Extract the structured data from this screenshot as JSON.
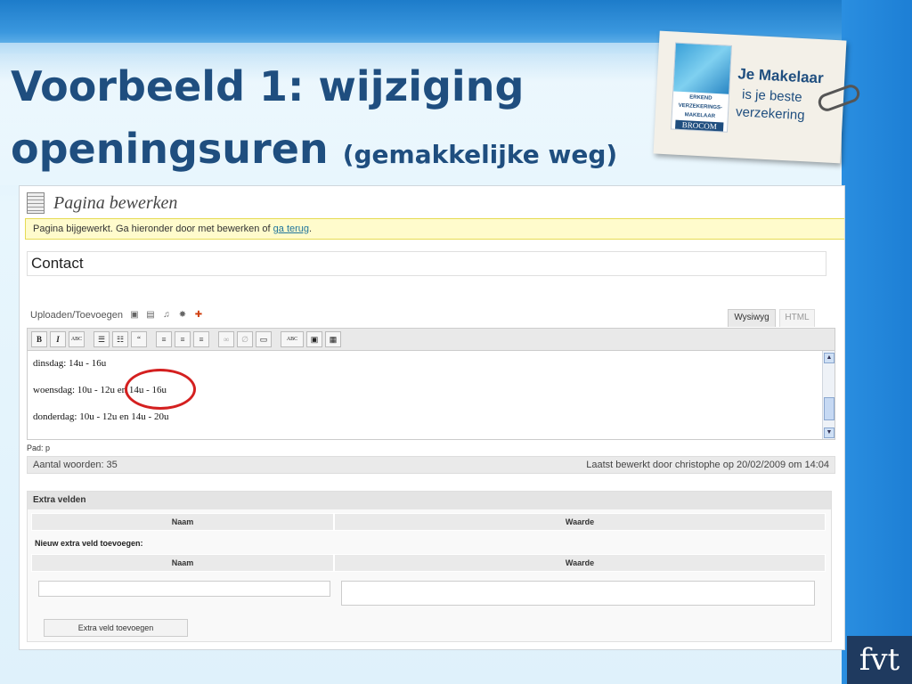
{
  "slide": {
    "title_line1": "Voorbeeld 1: wijziging",
    "title_line2": "openingsuren",
    "title_sub": "(gemakkelijke weg)"
  },
  "logo": {
    "badge_line1": "ERKEND",
    "badge_line2": "VERZEKERINGS-",
    "badge_line3": "MAKELAAR",
    "badge_brand": "BROCOM",
    "tag_line1": "Je Makelaar",
    "tag_line2": "is je beste",
    "tag_line3": "verzekering"
  },
  "editor_page": {
    "heading": "Pagina bewerken",
    "notice_text": "Pagina bijgewerkt. Ga hieronder door met bewerken of ",
    "notice_link": "ga terug",
    "notice_end": ".",
    "title_value": "Contact",
    "upload_label": "Uploaden/Toevoegen",
    "tab_wysiwyg": "Wysiwyg",
    "tab_html": "HTML",
    "toolbar": {
      "bold": "B",
      "italic": "I",
      "strike": "ABC",
      "bullets": "☰",
      "numbers": "☷",
      "quote": "“",
      "align_left": "≡",
      "align_center": "≡",
      "align_right": "≡",
      "link": "∞",
      "unlink": "∅",
      "more": "▭",
      "spell": "ABC",
      "fullscreen": "▣",
      "kitchen": "▦"
    },
    "content_lines": [
      "dinsdag: 14u - 16u",
      "woensdag: 10u - 12u en 14u - 16u",
      "donderdag: 10u - 12u en 14u - 20u"
    ],
    "path": "Pad: p",
    "word_count": "Aantal woorden: 35",
    "last_edited": "Laatst bewerkt door christophe op 20/02/2009 om 14:04"
  },
  "extra_fields": {
    "title": "Extra velden",
    "col_name": "Naam",
    "col_value": "Waarde",
    "new_label": "Nieuw extra veld toevoegen:",
    "add_button": "Extra veld toevoegen"
  },
  "footer_logo": "fvt",
  "colors": {
    "title": "#1f4e7f",
    "highlight": "#d42020",
    "notice_bg": "#fffbcc"
  }
}
